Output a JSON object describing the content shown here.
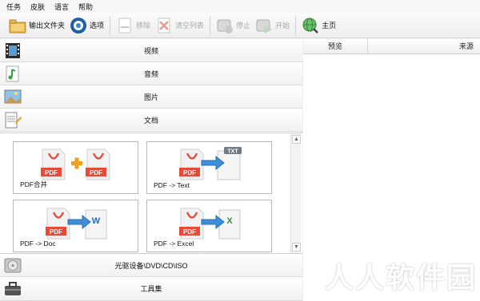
{
  "menu": [
    "任务",
    "皮肤",
    "语言",
    "帮助"
  ],
  "toolbar": {
    "output_folder": "输出文件夹",
    "options": "选项",
    "remove": "移除",
    "clear_list": "清空列表",
    "stop": "停止",
    "start": "开始",
    "home": "主页"
  },
  "categories": {
    "video": "视频",
    "audio": "音频",
    "image": "图片",
    "document": "文档",
    "rom": "光驱设备\\DVD\\CD\\ISO",
    "tools": "工具集"
  },
  "cards": [
    {
      "label": "PDF合并",
      "icon": "pdf-merge-icon"
    },
    {
      "label": "PDF -> Text",
      "icon": "pdf-to-text-icon"
    },
    {
      "label": "PDF -> Doc",
      "icon": "pdf-to-doc-icon"
    },
    {
      "label": "PDF -> Excel",
      "icon": "pdf-to-excel-icon"
    }
  ],
  "icon_texts": {
    "pdf": "PDF",
    "txt": "TXT",
    "word": "W",
    "excel": "X"
  },
  "table": {
    "col_preview": "预览",
    "col_source": "来源"
  },
  "watermark": "人人软件园",
  "colors": {
    "pdf_red": "#e84a3a",
    "arrow_blue": "#3f8fd8",
    "plus_orange": "#f0a020"
  }
}
